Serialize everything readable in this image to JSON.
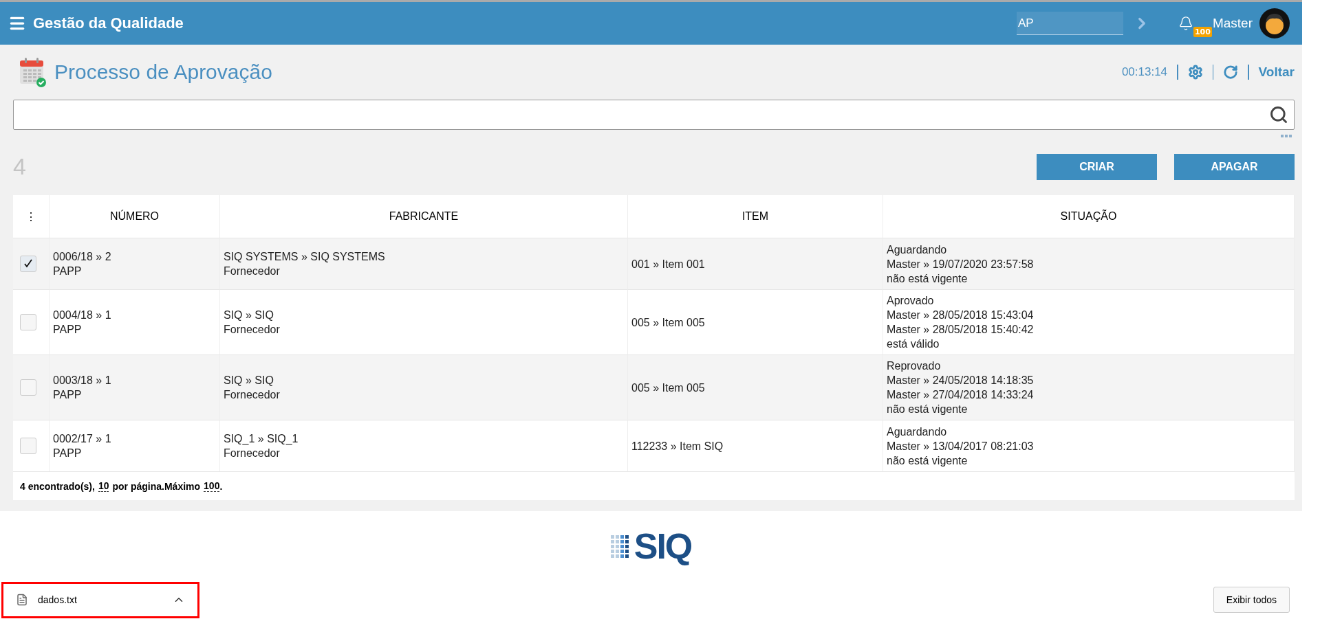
{
  "header": {
    "app_title": "Gestão da Qualidade",
    "module_field": "AP",
    "notification_count": "100",
    "user": "Master"
  },
  "page": {
    "title": "Processo de Aprovação",
    "timer": "00:13:14",
    "back_link": "Voltar"
  },
  "count": "4",
  "buttons": [
    "CRIAR",
    "APAGAR"
  ],
  "table": {
    "menu_glyph": "⋮",
    "columns": [
      "NÚMERO",
      "FABRICANTE",
      "ITEM",
      "SITUAÇÃO"
    ],
    "rows": [
      {
        "checked": true,
        "numero": [
          "0006/18 » 2",
          "PAPP"
        ],
        "fabricante": [
          "SIQ SYSTEMS » SIQ SYSTEMS",
          "Fornecedor"
        ],
        "item": "001 » Item 001",
        "situacao": [
          "Aguardando",
          "Master » 19/07/2020 23:57:58",
          "não está vigente"
        ]
      },
      {
        "checked": false,
        "numero": [
          "0004/18 » 1",
          "PAPP"
        ],
        "fabricante": [
          "SIQ » SIQ",
          "Fornecedor"
        ],
        "item": "005 » Item 005",
        "situacao": [
          "Aprovado",
          "Master » 28/05/2018 15:43:04",
          "Master » 28/05/2018 15:40:42",
          "está válido"
        ]
      },
      {
        "checked": false,
        "numero": [
          "0003/18 » 1",
          "PAPP"
        ],
        "fabricante": [
          "SIQ » SIQ",
          "Fornecedor"
        ],
        "item": "005 » Item 005",
        "situacao": [
          "Reprovado",
          "Master » 24/05/2018 14:18:35",
          "Master » 27/04/2018 14:33:24",
          "não está vigente"
        ]
      },
      {
        "checked": false,
        "numero": [
          "0002/17 » 1",
          "PAPP"
        ],
        "fabricante": [
          "SIQ_1 » SIQ_1",
          "Fornecedor"
        ],
        "item": "112233 » Item SIQ",
        "situacao": [
          "Aguardando",
          "Master » 13/04/2017 08:21:03",
          "não está vigente"
        ]
      }
    ],
    "footer": {
      "found": "4 encontrado(s),",
      "per_page": "10",
      "per_page_label": "por página.Máximo",
      "max": "100",
      "end": "."
    }
  },
  "logo": {
    "text": "SIQ"
  },
  "downloads": {
    "file": "dados.txt",
    "show_all": "Exibir todos"
  }
}
